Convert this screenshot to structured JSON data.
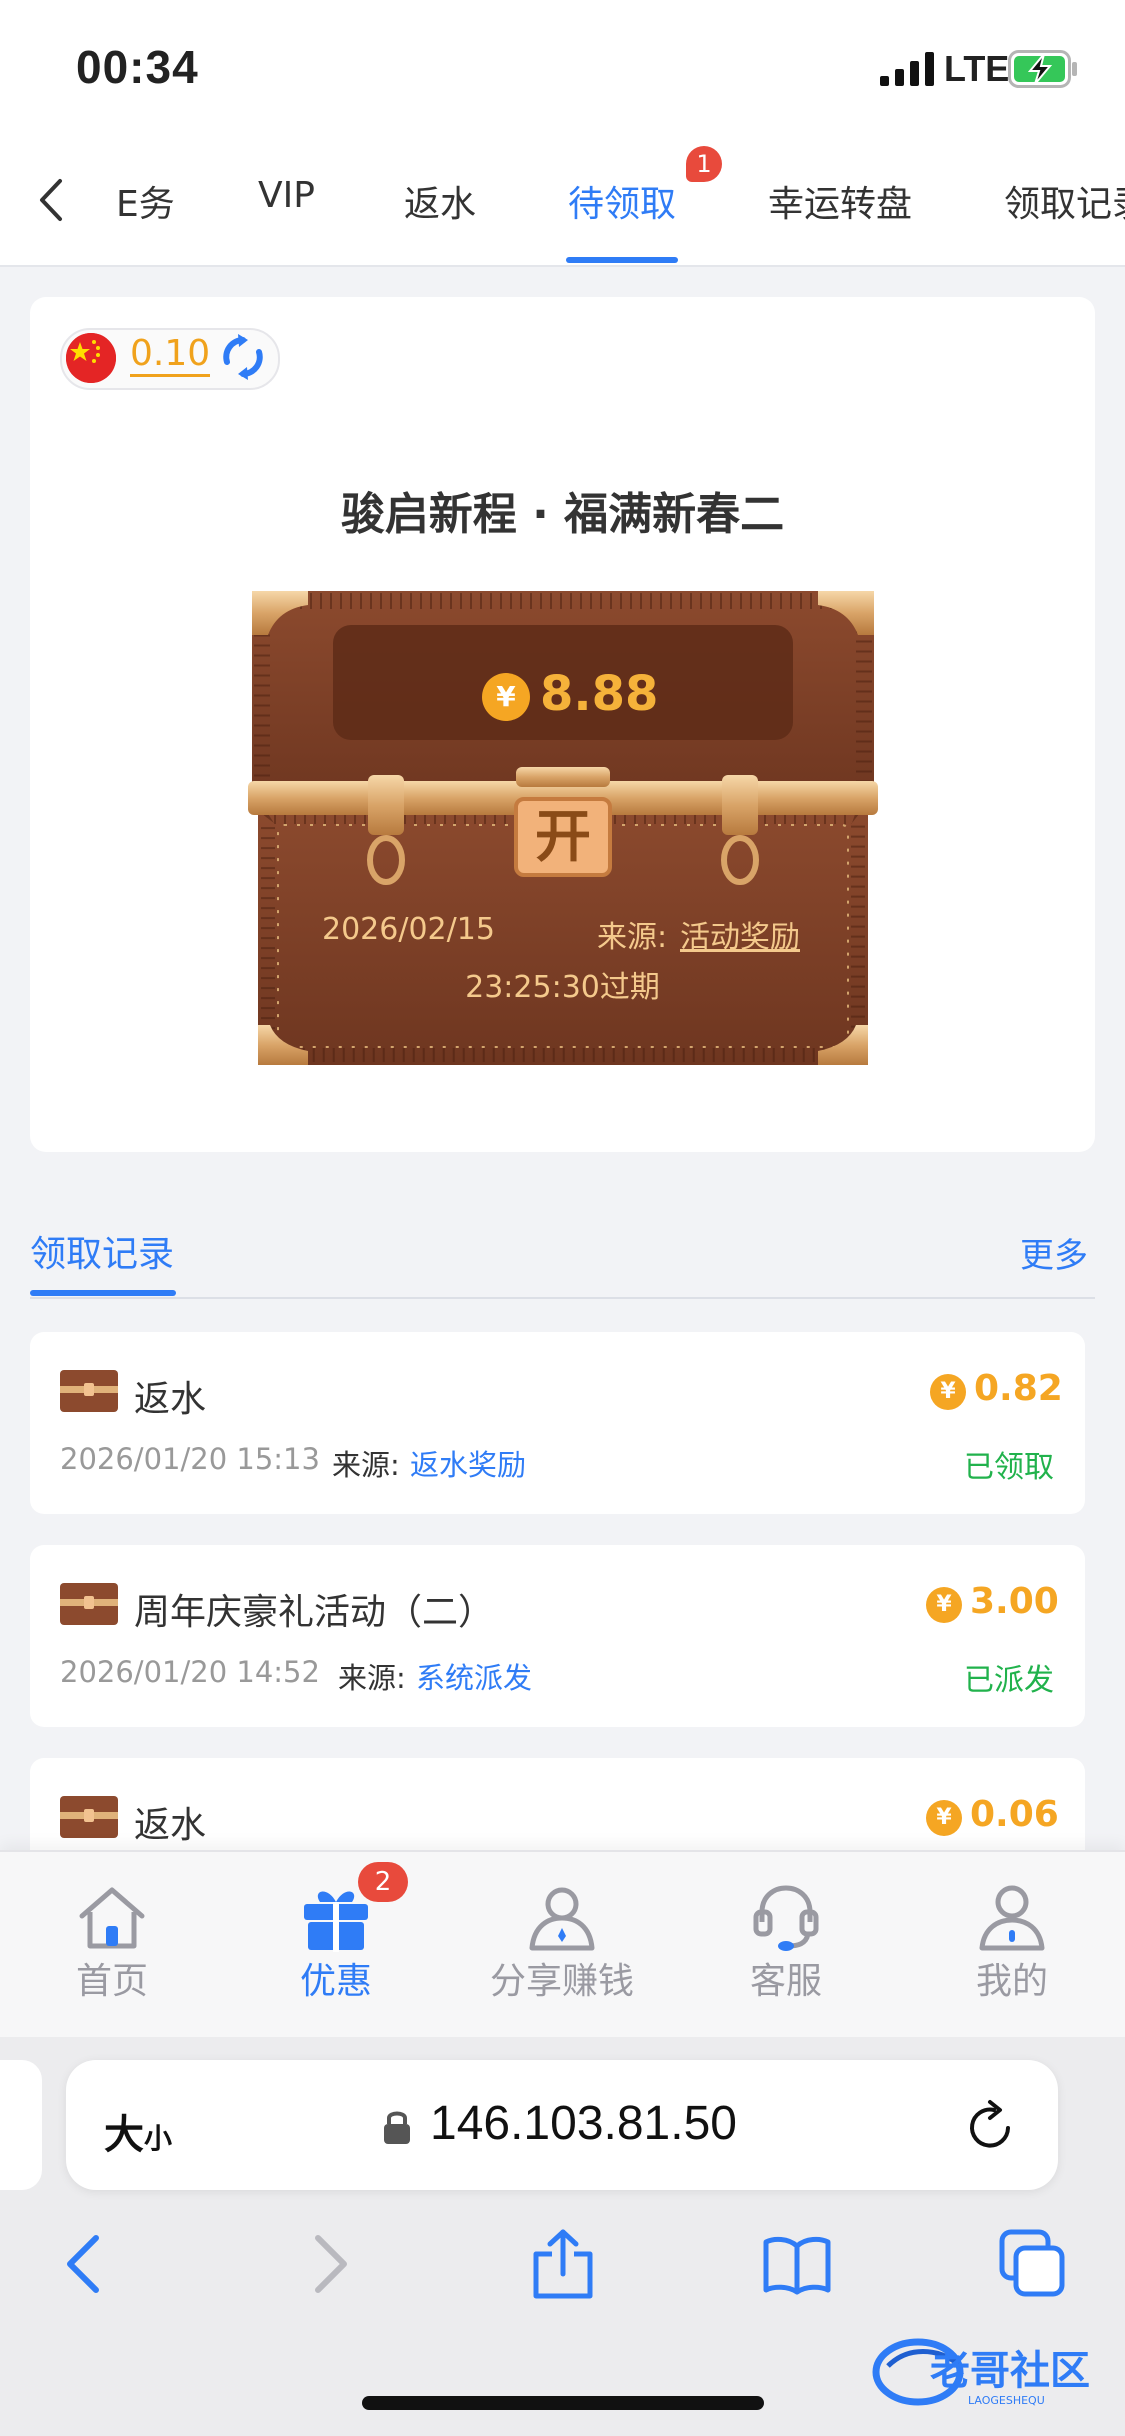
{
  "status_bar": {
    "time": "00:34",
    "network": "LTE"
  },
  "tabs": {
    "items": [
      {
        "label": "任务",
        "visible_label": "E务"
      },
      {
        "label": "VIP"
      },
      {
        "label": "返水"
      },
      {
        "label": "待领取",
        "badge": "1"
      },
      {
        "label": "幸运转盘"
      },
      {
        "label": "领取记录"
      }
    ],
    "active_index": 3
  },
  "balance": {
    "value": "0.10",
    "currency_flag": "china-flag-icon"
  },
  "reward": {
    "title": "骏启新程 · 福满新春二",
    "currency_symbol": "¥",
    "amount": "8.88",
    "open_label": "开",
    "date": "2026/02/15",
    "source_label": "来源:",
    "source": "活动奖励",
    "expire": "23:25:30过期"
  },
  "records": {
    "title": "领取记录",
    "more": "更多",
    "source_label": "来源:",
    "items": [
      {
        "name": "返水",
        "amount": "0.82",
        "date": "2026/01/20 15:13",
        "source": "返水奖励",
        "status": "已领取"
      },
      {
        "name": "周年庆豪礼活动（二）",
        "amount": "3.00",
        "date": "2026/01/20 14:52",
        "source": "系统派发",
        "status": "已派发"
      },
      {
        "name": "返水",
        "amount": "0.06"
      }
    ]
  },
  "bottom_nav": {
    "items": [
      {
        "label": "首页",
        "icon": "home-icon"
      },
      {
        "label": "优惠",
        "icon": "gift-icon",
        "badge": "2",
        "active": true
      },
      {
        "label": "分享赚钱",
        "icon": "share-earn-icon"
      },
      {
        "label": "客服",
        "icon": "headset-icon"
      },
      {
        "label": "我的",
        "icon": "profile-icon"
      }
    ]
  },
  "browser": {
    "text_size_big": "大",
    "text_size_small": "小",
    "url": "146.103.81.50"
  },
  "colors": {
    "accent": "#2f7cf6",
    "coin": "#f5a623",
    "success": "#21b24c",
    "badge": "#e84a3c"
  }
}
